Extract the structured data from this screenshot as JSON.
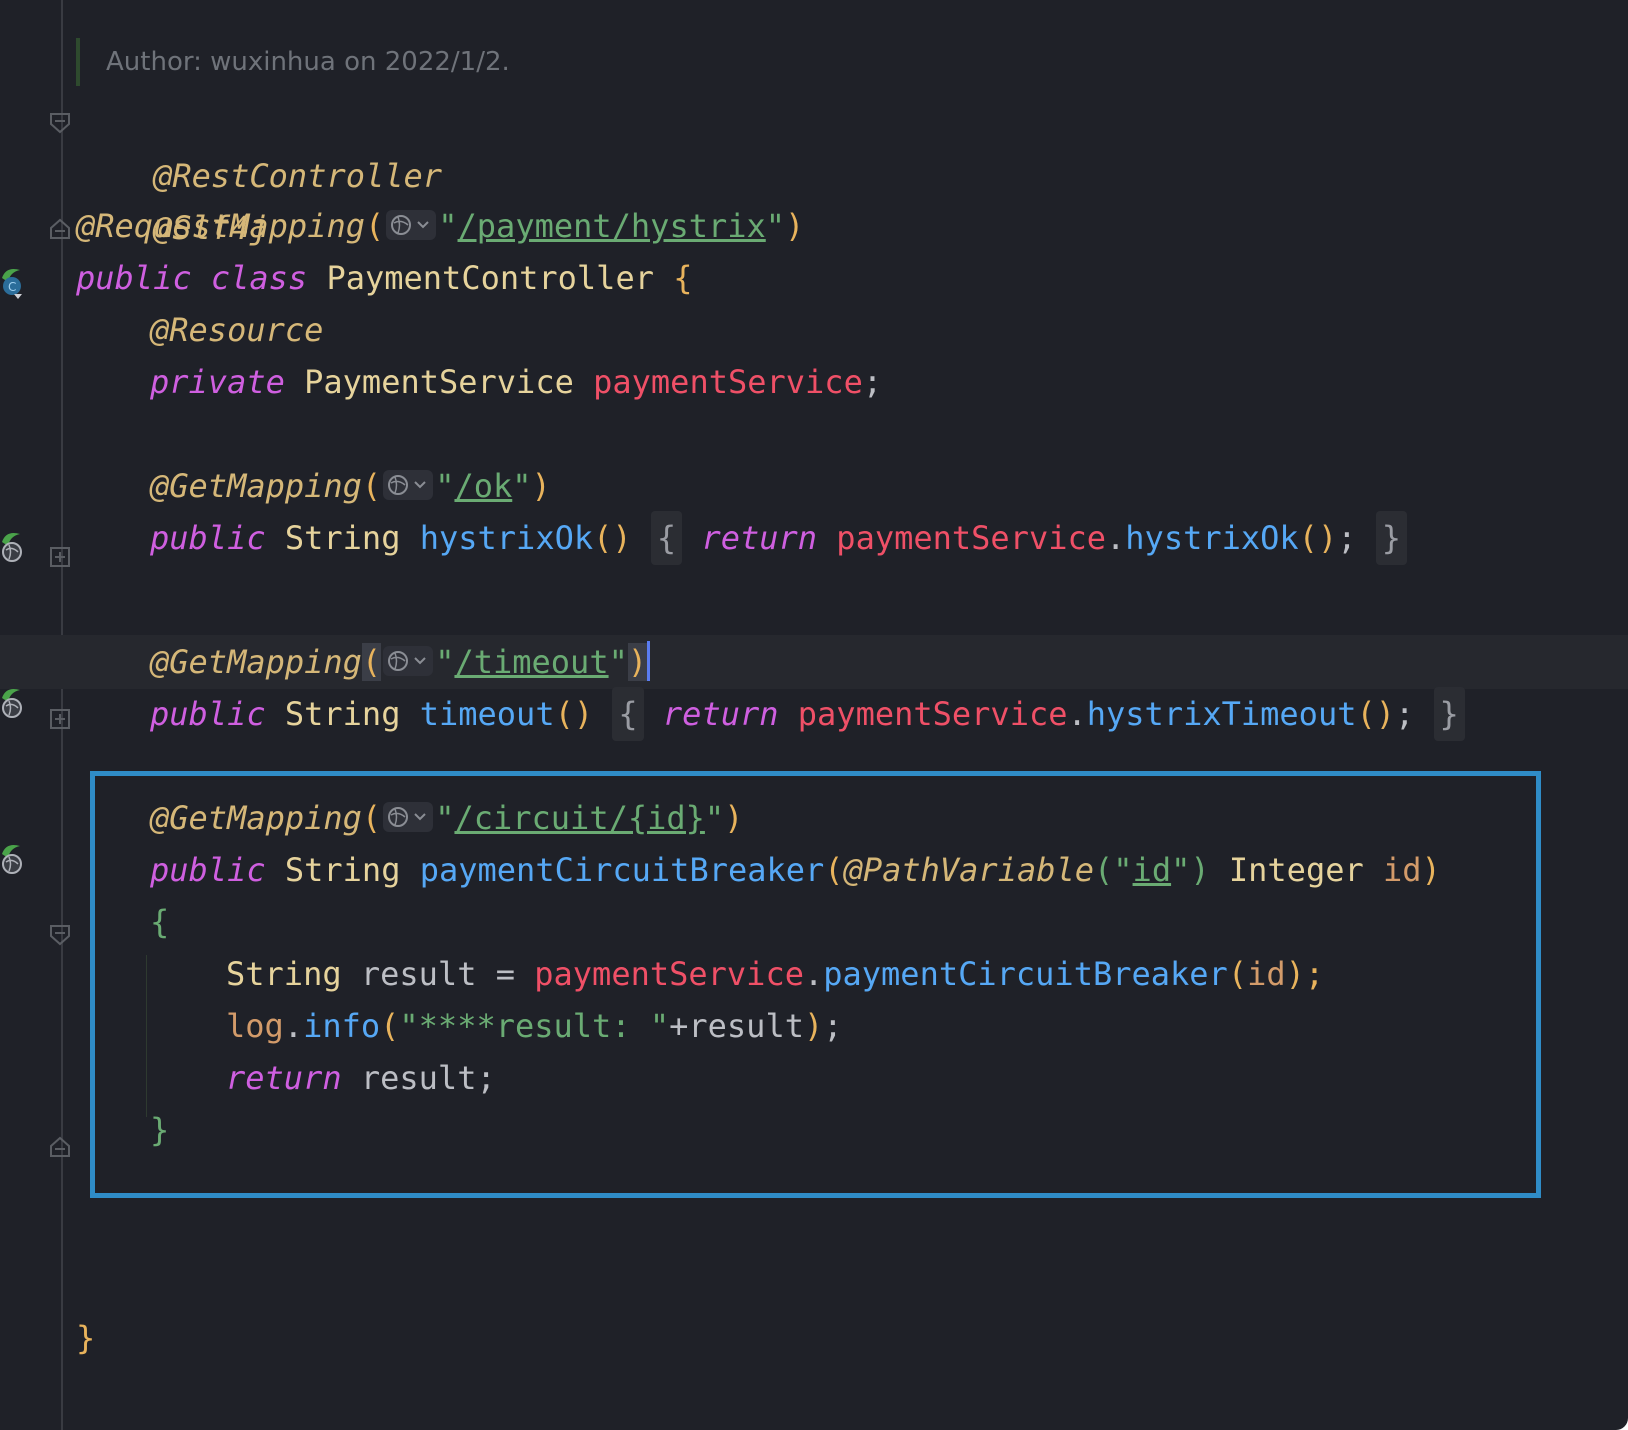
{
  "editor": {
    "author_comment": "Author: wuxinhua on 2022/1/2.",
    "annotations": {
      "rest_controller": "@RestController",
      "slf4j": "@Slf4j",
      "request_mapping": "@RequestMapping",
      "resource": "@Resource",
      "get_mapping": "@GetMapping",
      "path_variable": "@PathVariable"
    },
    "keywords": {
      "public": "public",
      "class": "class",
      "private": "private",
      "return": "return"
    },
    "types": {
      "string": "String",
      "integer": "Integer",
      "payment_service_type": "PaymentService"
    },
    "identifiers": {
      "class_name": "PaymentController",
      "payment_service_field": "paymentService",
      "hystrix_ok_method": "hystrixOk",
      "timeout_method": "timeout",
      "hystrix_timeout_method": "hystrixTimeout",
      "circuit_breaker_method": "paymentCircuitBreaker",
      "id_param": "id",
      "result_var": "result",
      "log_var": "log",
      "info_method": "info"
    },
    "strings": {
      "base_path": "/payment/hystrix",
      "ok_path": "/ok",
      "timeout_path": "/timeout",
      "circuit_path": "/circuit/{id}",
      "id_name": "id",
      "log_message": "\"****result: \""
    },
    "punctuation": {
      "open_brace": "{",
      "close_brace": "}",
      "open_paren": "(",
      "close_paren": ")",
      "empty_parens": "()",
      "semicolon": ";",
      "dot": ".",
      "equals": "=",
      "plus": "+",
      "quote": "\"",
      "call_end": "();",
      "id_call_end": ");"
    },
    "colors": {
      "background": "#1f2128",
      "annotation": "#d5b778",
      "keyword": "#cf5fe0",
      "field": "#ef5067",
      "method": "#56a8f5",
      "string": "#6aab73",
      "selection_frame": "#2f8cc7"
    },
    "icons": {
      "endpoint_gutter": "web-endpoint-icon",
      "class_gutter": "spring-bean-icon",
      "inlay": "globe-dropdown-icon"
    }
  }
}
